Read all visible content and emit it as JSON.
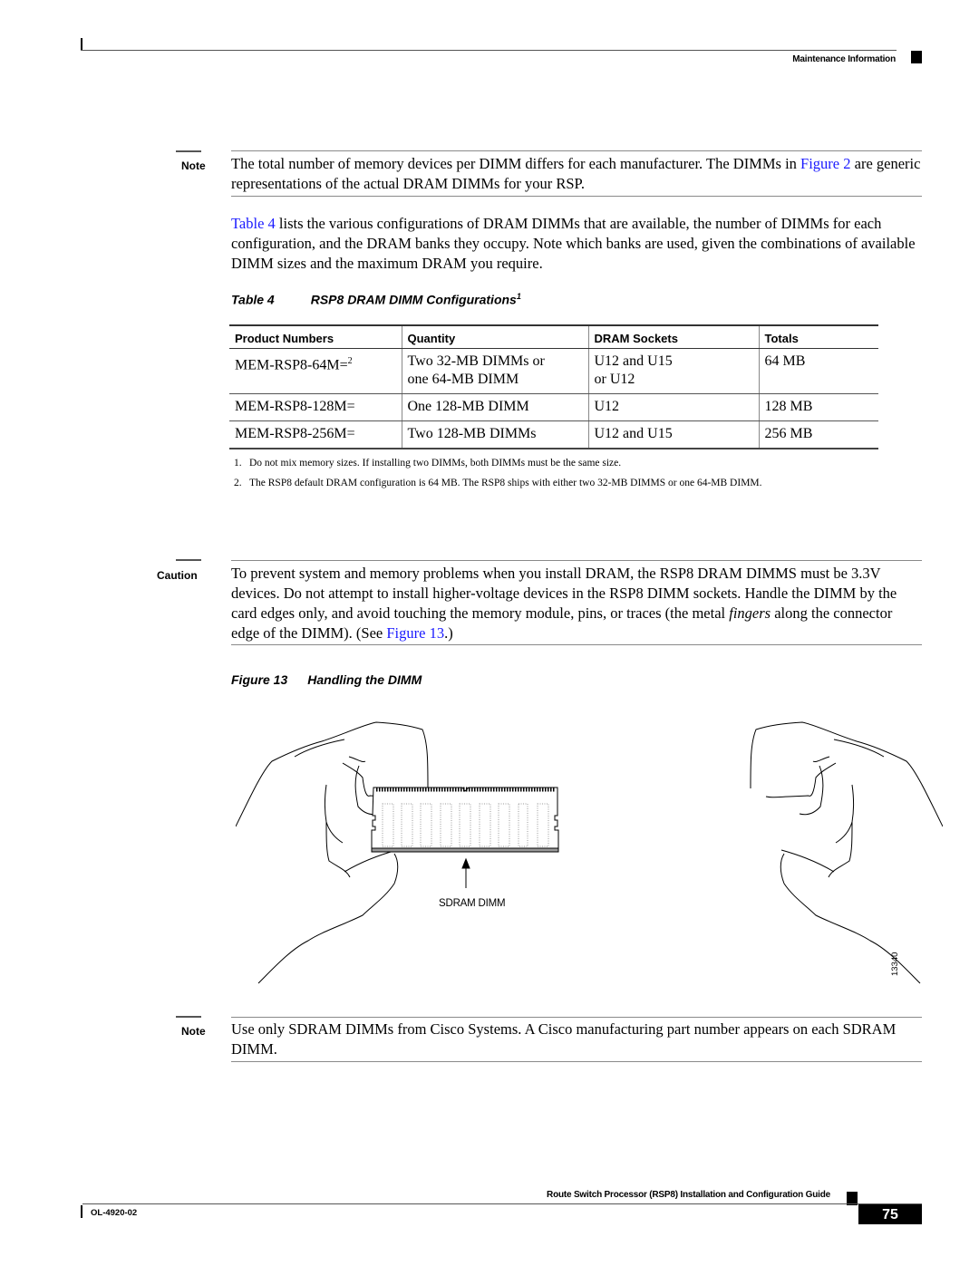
{
  "header": {
    "section": "Maintenance Information"
  },
  "note1": {
    "label": "Note",
    "text_before": "The total number of memory devices per DIMM differs for each manufacturer. The DIMMs in ",
    "link": "Figure 2",
    "text_after": " are generic representations of the actual DRAM DIMMs for your RSP."
  },
  "intro": {
    "link": "Table 4",
    "text": " lists the various configurations of DRAM DIMMs that are available, the number of DIMMs for each configuration, and the DRAM banks they occupy. Note which banks are used, given the combinations of available DIMM sizes and the maximum DRAM you require."
  },
  "table": {
    "number": "Table 4",
    "title": "RSP8 DRAM DIMM Configurations",
    "title_footnote": "1",
    "columns": [
      "Product Numbers",
      "Quantity",
      "DRAM Sockets",
      "Totals"
    ],
    "rows": [
      {
        "product": "MEM-RSP8-64M=",
        "product_footnote": "2",
        "quantity": "Two 32-MB DIMMs or one 64-MB DIMM",
        "sockets": "U12 and U15 or U12",
        "total": "64 MB"
      },
      {
        "product": "MEM-RSP8-128M=",
        "product_footnote": "",
        "quantity": "One 128-MB DIMM",
        "sockets": "U12",
        "total": "128 MB"
      },
      {
        "product": "MEM-RSP8-256M=",
        "product_footnote": "",
        "quantity": "Two 128-MB DIMMs",
        "sockets": "U12 and U15",
        "total": "256 MB"
      }
    ],
    "footnotes": [
      {
        "num": "1.",
        "text": "Do not mix memory sizes. If installing two DIMMs, both DIMMs must be the same size."
      },
      {
        "num": "2.",
        "text": "The RSP8 default DRAM configuration is 64 MB. The RSP8 ships with either two 32-MB DIMMS or one 64-MB DIMM."
      }
    ]
  },
  "caution": {
    "label": "Caution",
    "text_before": "To prevent system and memory problems when you install DRAM, the RSP8 DRAM DIMMS must be 3.3V devices. Do not attempt to install higher-voltage devices in the RSP8 DIMM sockets. Handle the DIMM by the card edges only, and avoid touching the memory module, pins, or traces (the metal ",
    "italic": "fingers",
    "text_middle": " along the connector edge of the DIMM). (See ",
    "link": "Figure 13",
    "text_after": ".)"
  },
  "figure": {
    "number": "Figure 13",
    "title": "Handling the DIMM",
    "callout": "SDRAM DIMM",
    "art_id": "13340"
  },
  "note2": {
    "label": "Note",
    "text": "Use only SDRAM DIMMs from Cisco Systems. A Cisco manufacturing part number appears on each SDRAM DIMM."
  },
  "footer": {
    "guide_title": "Route Switch Processor (RSP8) Installation and Configuration Guide",
    "doc_number": "OL-4920-02",
    "page_number": "75"
  }
}
